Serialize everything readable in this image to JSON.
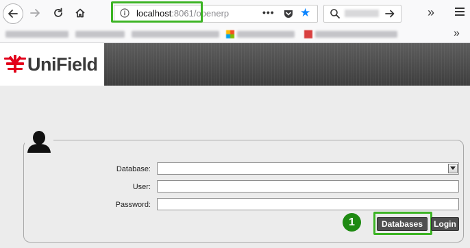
{
  "browser": {
    "url_host": "localhost",
    "url_rest": ":8061/openerp",
    "url_dots": "•••",
    "overflow": "»",
    "bookmarks_overflow": "»"
  },
  "app": {
    "logo_text": "UniField",
    "brand_color": "#e2001a"
  },
  "login": {
    "database_label": "Database:",
    "database_value": "",
    "user_label": "User:",
    "user_value": "",
    "password_label": "Password:",
    "password_value": "",
    "databases_button": "Databases",
    "login_button": "Login"
  },
  "annotation": {
    "step_number": "1",
    "highlight_color": "#3cb424"
  }
}
